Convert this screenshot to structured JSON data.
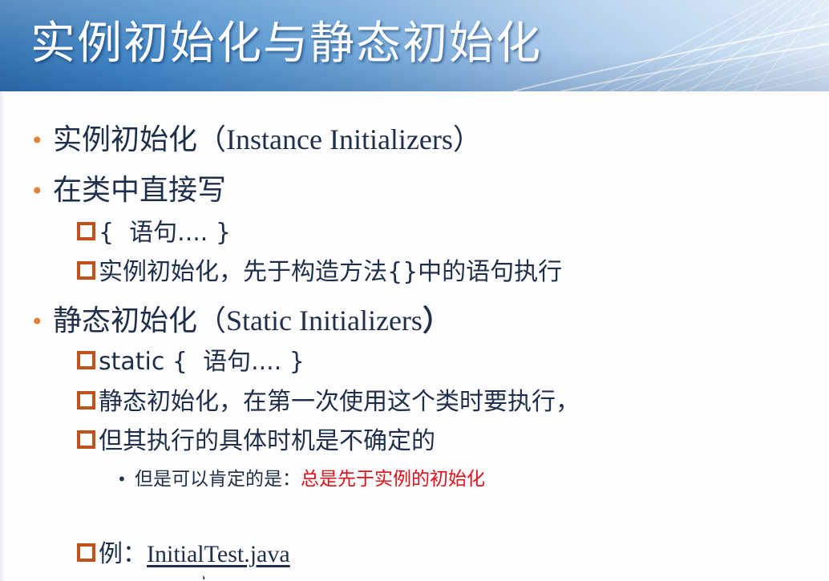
{
  "title": "实例初始化与静态初始化",
  "bullets": {
    "b1": {
      "cn": "实例初始化（",
      "en": "Instance Initializers",
      "close": "）"
    },
    "b2": {
      "text": "在类中直接写"
    },
    "b2_sub1": {
      "brace_open": "{",
      "cn": "语句....",
      "brace_close": "}"
    },
    "b2_sub2": {
      "text": "实例初始化，先于构造方法{}中的语句执行"
    },
    "b3": {
      "cn": "静态初始化（",
      "en": "Static Initializers",
      "close": "）"
    },
    "b3_sub1": {
      "kw": "static",
      "brace_open": "{",
      "cn": "语句....",
      "brace_close": "}"
    },
    "b3_sub2": {
      "text": "静态初始化，在第一次使用这个类时要执行，"
    },
    "b3_sub3": {
      "text": "但其执行的具体时机是不确定的"
    },
    "b3_sub3_note": {
      "prefix": "但是可以肯定的是：",
      "emphasis": "总是先于实例的初始化"
    },
    "example": {
      "prefix": "例：",
      "link": "InitialTest.java"
    }
  },
  "colors": {
    "bullet": "#e0823a",
    "box": "#c0511a",
    "text": "#1f2f4a",
    "emphasis": "#e0101a",
    "banner": "#3f86c7"
  }
}
